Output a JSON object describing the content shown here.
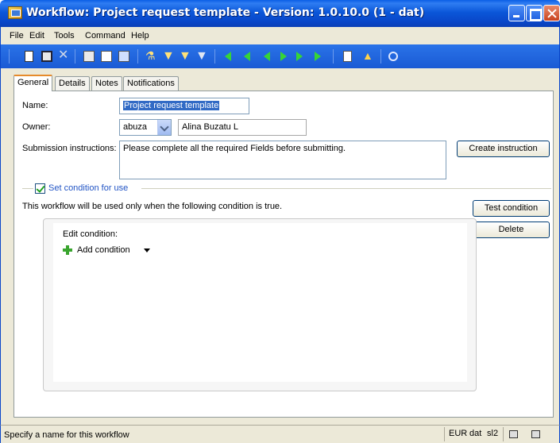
{
  "window": {
    "title": "Workflow: Project request template - Version: 1.0.10.0 (1 - dat)"
  },
  "menu": [
    "File",
    "Edit",
    "Tools",
    "Command",
    "Help"
  ],
  "toolbar": {
    "icons": [
      "new-icon",
      "save-icon",
      "delete-icon",
      "print-icon",
      "print-preview-icon",
      "refresh-icon",
      "filter-icon",
      "filter-by-selection-icon",
      "advanced-filter-icon",
      "clear-filter-icon",
      "first-record-icon",
      "previous-page-icon",
      "previous-record-icon",
      "next-record-icon",
      "next-page-icon",
      "last-record-icon",
      "document-icon",
      "alert-icon",
      "help-icon"
    ]
  },
  "tabs": [
    "General",
    "Details",
    "Notes",
    "Notifications"
  ],
  "active_tab": "General",
  "form": {
    "name_label": "Name:",
    "name_value": "Project request template",
    "owner_label": "Owner:",
    "owner_id": "abuza",
    "owner_name": "Alina Buzatu L",
    "instructions_label": "Submission instructions:",
    "instructions_value": "Please complete all the required Fields before submitting.",
    "create_instruction_button": "Create instruction"
  },
  "condition": {
    "checkbox_label": "Set condition for use",
    "checked": true,
    "description": "This workflow will be used only when the following condition is true.",
    "test_button": "Test condition",
    "delete_button": "Delete",
    "edit_label": "Edit condition:",
    "add_label": "Add condition"
  },
  "status": {
    "message": "Specify a name for this workflow",
    "currency": "EUR",
    "company": "dat",
    "layer": "sl2"
  },
  "colors": {
    "titlebar": "#0b57d9",
    "toolbar": "#2a73e8",
    "selection": "#316ac5",
    "tab_accent": "#e68b2c",
    "plus": "#3aa52f"
  }
}
